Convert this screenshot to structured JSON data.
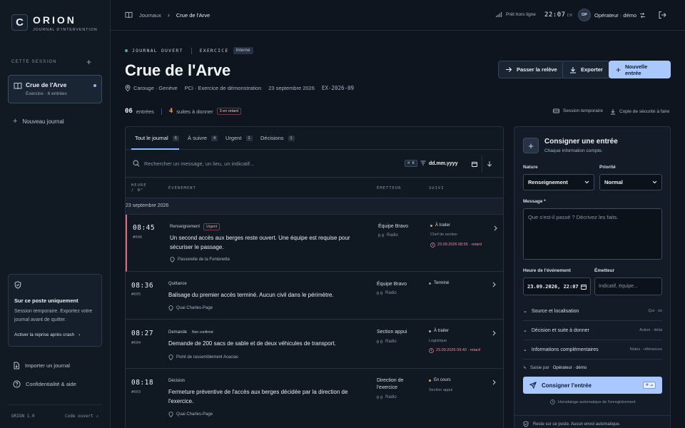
{
  "app": {
    "logo_letter": "C",
    "name": "ORION",
    "subtitle": "JOURNAL D'INTERVENTION",
    "version": "ORION 1.0",
    "code_link": "Code ouvert ↗"
  },
  "sidebar": {
    "session_label": "CETTE SESSION",
    "journal": {
      "title": "Crue de l'Arve",
      "sub": "Exercice · 6 entrées"
    },
    "new_journal": "Nouveau journal",
    "post_card": {
      "title": "Sur ce poste uniquement",
      "text": "Session temporaire. Exportez votre journal avant de quitter.",
      "link": "Activer la reprise après crash"
    },
    "import": "Importer un journal",
    "privacy": "Confidentialité & aide"
  },
  "topbar": {
    "crumb_root": "Journaux",
    "crumb_current": "Crue de l'Arve",
    "offline": "Prêt hors ligne",
    "clock": "22:07",
    "clock_tz": "CH",
    "avatar": "OP",
    "operator": "Opérateur · démo"
  },
  "header": {
    "status": "JOURNAL OUVERT",
    "mode": "EXERCICE",
    "tag": "Interne",
    "title": "Crue de l'Arve",
    "place": "Carouge · Genève",
    "plan": "PCi · Exercice de démonstration",
    "date": "23 septembre 2026",
    "ref": "EX-2026-09",
    "btn_releve": "Passer la relève",
    "btn_export": "Exporter",
    "btn_new": "Nouvelle entrée",
    "count_entries": "06",
    "count_entries_label": "entrées",
    "count_follow": "4",
    "count_follow_label": "suites à donner",
    "late_badge": "3 en retard",
    "session_temp": "Session temporaire",
    "backup": "Copie de sécurité à faire"
  },
  "tabs": [
    {
      "label": "Tout le journal",
      "count": "6"
    },
    {
      "label": "À suivre",
      "count": "4"
    },
    {
      "label": "Urgent",
      "count": "1"
    },
    {
      "label": "Décisions",
      "count": "1"
    }
  ],
  "search": {
    "placeholder": "Rechercher un message, un lieu, un indicatif...",
    "kbd": "⌘ K",
    "date_placeholder": "dd.mm.yyyy"
  },
  "columns": {
    "time": "HEURE / N°",
    "event": "ÉVÉNEMENT",
    "emitter": "ÉMETTEUR",
    "follow": "SUIVI"
  },
  "date_group": "23 septembre 2026",
  "entries": [
    {
      "time": "08:45",
      "num": "#006",
      "type": "Renseignement",
      "badge": "Urgent",
      "msg": "Un second accès aux berges reste ouvert. Une équipe est requise pour sécuriser le passage.",
      "place": "Passerelle de la Fontenette",
      "emitter": "Équipe Bravo",
      "channel": "Radio",
      "status": "À traiter",
      "status_color": "#f0a04b",
      "who": "Chef de section",
      "late": "23.09.2026 08:55 · retard"
    },
    {
      "time": "08:36",
      "num": "#005",
      "type": "Quittance",
      "badge": "",
      "msg": "Balisage du premier accès terminé. Aucun civil dans le périmètre.",
      "place": "Quai Charles-Page",
      "emitter": "Équipe Bravo",
      "channel": "Radio",
      "status": "Terminé",
      "status_color": "#8793a3",
      "who": "",
      "late": ""
    },
    {
      "time": "08:27",
      "num": "#004",
      "type": "Demande",
      "badge": "Non confirmé",
      "msg": "Demande de 200 sacs de sable et de deux véhicules de transport.",
      "place": "Point de rassemblement Acacias",
      "emitter": "Section appui",
      "channel": "Radio",
      "status": "À traiter",
      "status_color": "#f0a04b",
      "who": "Logistique",
      "late": "23.09.2026 09:40 · retard"
    },
    {
      "time": "08:18",
      "num": "#003",
      "type": "Décision",
      "badge": "",
      "msg": "Fermeture préventive de l'accès aux berges décidée par la direction de l'exercice.",
      "place": "Quai Charles-Page",
      "emitter": "Direction de l'exercice",
      "channel": "Radio",
      "status": "En cours",
      "status_color": "#f0a04b",
      "who": "Section appui",
      "late": ""
    }
  ],
  "form": {
    "title": "Consigner une entrée",
    "sub": "Chaque information compte.",
    "nature_label": "Nature",
    "nature_value": "Renseignement",
    "priority_label": "Priorité",
    "priority_value": "Normal",
    "message_label": "Message *",
    "message_placeholder": "Que s'est-il passé ? Décrivez les faits.",
    "time_label": "Heure de l'événement",
    "time_value": "23.09.2026, 22:07",
    "emitter_label": "Émetteur",
    "emitter_placeholder": "Indicatif, équipe...",
    "acc_source": "Source et localisation",
    "acc_source_hint": "Qui · où",
    "acc_decision": "Décision et suite à donner",
    "acc_decision_hint": "Action · délai",
    "acc_info": "Informations complémentaires",
    "acc_info_hint": "Notes · références",
    "by_prefix": "Saisie par",
    "by_name": "Opérateur · démo",
    "submit": "Consigner l'entrée",
    "submit_kbd": "⌘ ↵",
    "auto": "Horodatage automatique de l'enregistrement",
    "footer": "Reste sur ce poste. Aucun envoi automatique."
  },
  "colors": {
    "accent": "#a9c8ff",
    "urgent": "#e46a7c",
    "ok": "#3fb97a",
    "warning": "#f0a04b"
  }
}
